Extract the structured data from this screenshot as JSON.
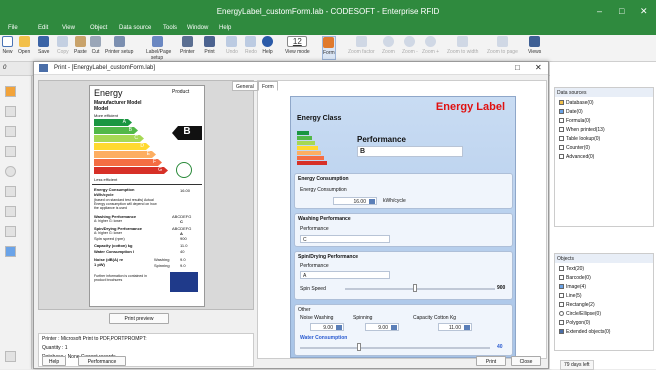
{
  "window": {
    "title": "EnergyLabel_customForm.lab - CODESOFT - Enterprise RFID",
    "min": "–",
    "max": "□",
    "close": "✕"
  },
  "menu": [
    "File",
    "Edit",
    "View",
    "Object",
    "Data source",
    "Tools",
    "Window",
    "Help"
  ],
  "ribbon": [
    "New",
    "Open",
    "Save",
    "Copy",
    "Paste",
    "Cut",
    "Printer setup",
    "Label/Page setup",
    "Printer",
    "Print",
    "Undo",
    "Redo",
    "Help",
    "View mode",
    "Form",
    "Zoom factor",
    "Zoom",
    "Zoom -",
    "Zoom +",
    "Zoom to width",
    "Zoom to page",
    "Views"
  ],
  "zoom_value": "12",
  "toolbar2_value": "0",
  "dialog": {
    "title": "Print - [EnergyLabel_customForm.lab]",
    "tabs": [
      "General",
      "Form"
    ],
    "print_preview": "Print preview",
    "printer_info": "Printer : Microsoft Print to PDF,PORTPROMPT:",
    "quantity": "Quantity : 1",
    "database": "Database : None,Current records",
    "help": "Help",
    "performance": "Performance",
    "print": "Print",
    "close": "Close"
  },
  "label": {
    "title": "Energy",
    "product": "Product",
    "manufacturer": "Manufacturer Model",
    "model": "Model",
    "more_efficient": "More efficient",
    "less_efficient": "Less efficient",
    "grade": "B",
    "classes": [
      "A",
      "B",
      "C",
      "D",
      "E",
      "F",
      "G"
    ],
    "colors": [
      "#1a9641",
      "#52b848",
      "#a6d854",
      "#ffd92f",
      "#fdae61",
      "#f46d43",
      "#d73027"
    ],
    "consumption": "Energy Consumption kWh/cycle",
    "cons_note": "(based on standard test results) Actual Energy consumption will depend on how the appliance is used",
    "cons_val": "16.00",
    "washing": "Washing Performance",
    "washing_sub": "A: higher  G: lower",
    "washing_val": "C",
    "spin": "Spin/Drying Performance",
    "spin_sub": "A: higher  G: lower",
    "spin_val": "A",
    "spin_speed": "Spin speed (rpm)",
    "spin_speed_val": "900",
    "capacity": "Capacity (cotton) kg",
    "capacity_val": "11.0",
    "water": "Water Consumption l",
    "water_val": "40",
    "noise": "Noise (dB(A) re 1 pW)",
    "noise_washing": "Washing",
    "noise_spinning": "Spinning",
    "noise_w": "9.0",
    "noise_s": "9.0",
    "scale": "ABCDEFG",
    "further": "Further information is contained in product brochures"
  },
  "form": {
    "heading": "Energy Label",
    "energy_class": "Energy Class",
    "performance": "Performance",
    "perf_value": "B",
    "cons_group": "Energy Consumption",
    "cons_label": "Energy Consumption",
    "cons_value": "16.00",
    "cons_unit": "kWh/cycle",
    "wash_group": "Washing Performance",
    "wash_label": "Performance",
    "wash_value": "C",
    "spin_group": "Spin/Drying Performance",
    "spin_label": "Performance",
    "spin_value": "A",
    "spin_speed": "Spin Speed",
    "spin_speed_val": "900",
    "spin_fraction": 0.45,
    "other_group": "Other",
    "noise_wash": "Noise Washing",
    "noise_wash_val": "9.00",
    "spinning": "Spinning",
    "spinning_val": "9.00",
    "capacity": "Capacity Cotton Kg",
    "capacity_val": "11.00",
    "water": "Water Consumption",
    "water_val": "40",
    "water_fraction": 0.3
  },
  "datasources": {
    "title": "Data sources",
    "items": [
      "Database(0)",
      "Date(0)",
      "Formula(0)",
      "When printed(13)",
      "Table lookup(0)",
      "Counter(0)",
      "Advanced(0)"
    ]
  },
  "objects": {
    "title": "Objects",
    "items": [
      "Text(20)",
      "Barcode(0)",
      "Image(4)",
      "Line(5)",
      "Rectangle(2)",
      "Circle/Ellipse(0)",
      "Polygon(0)",
      "Extended objects(0)"
    ]
  },
  "status": "79 days left"
}
